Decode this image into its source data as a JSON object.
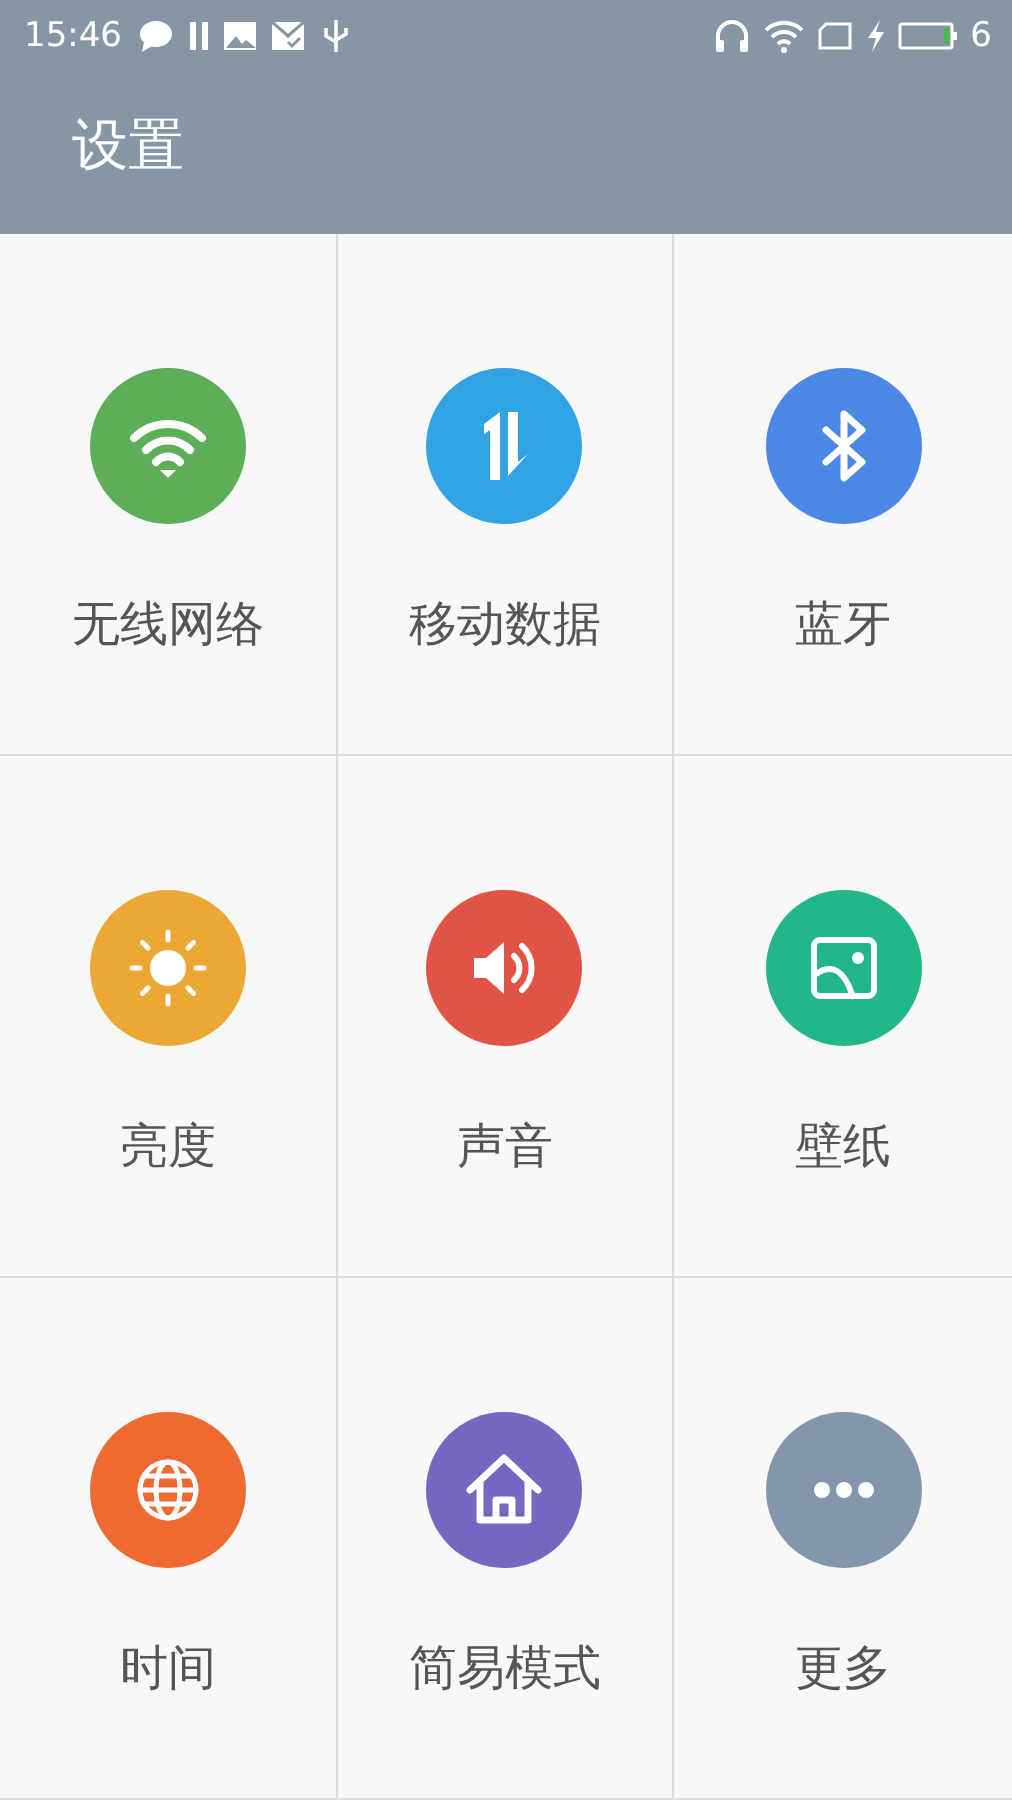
{
  "status_bar": {
    "time": "15:46",
    "battery_text": "6"
  },
  "header": {
    "title": "设置"
  },
  "tiles": [
    {
      "kind": "wifi",
      "label": "无线网络",
      "color": "#5cae57"
    },
    {
      "kind": "data",
      "label": "移动数据",
      "color": "#2fa3e3"
    },
    {
      "kind": "bluetooth",
      "label": "蓝牙",
      "color": "#4a87e6"
    },
    {
      "kind": "brightness",
      "label": "亮度",
      "color": "#eba837"
    },
    {
      "kind": "sound",
      "label": "声音",
      "color": "#e05445"
    },
    {
      "kind": "wallpaper",
      "label": "壁纸",
      "color": "#23b68b"
    },
    {
      "kind": "time",
      "label": "时间",
      "color": "#ef6a30"
    },
    {
      "kind": "home",
      "label": "简易模式",
      "color": "#7367c0"
    },
    {
      "kind": "more",
      "label": "更多",
      "color": "#8496ab"
    }
  ]
}
